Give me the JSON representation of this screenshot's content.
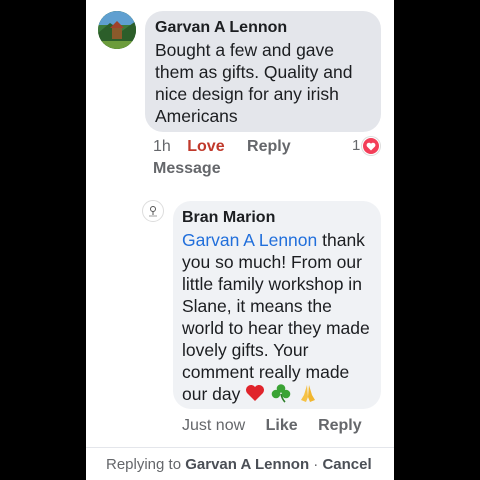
{
  "comment": {
    "author": "Garvan A Lennon",
    "text": "Bought a few and gave them as gifts. Quality and nice design for any irish Americans",
    "time": "1h",
    "love_label": "Love",
    "reply_label": "Reply",
    "message_label": "Message",
    "reaction_count": "1",
    "reaction_icon": "heart-icon"
  },
  "reply": {
    "author": "Bran Marion",
    "mention": "Garvan A Lennon",
    "text": " thank you so much! From our little family workshop in Slane, it means the world to hear they made lovely gifts. Your comment really made our day",
    "emojis": [
      "red-heart",
      "shamrock",
      "folded-hands"
    ],
    "time": "Just now",
    "like_label": "Like",
    "reply_label": "Reply"
  },
  "reply_bar": {
    "prefix": "Replying to ",
    "name": "Garvan A Lennon",
    "separator": " · ",
    "cancel_label": "Cancel"
  },
  "colors": {
    "love": "#c0392b",
    "mention": "#216fdb",
    "heart": "#f33e58"
  }
}
